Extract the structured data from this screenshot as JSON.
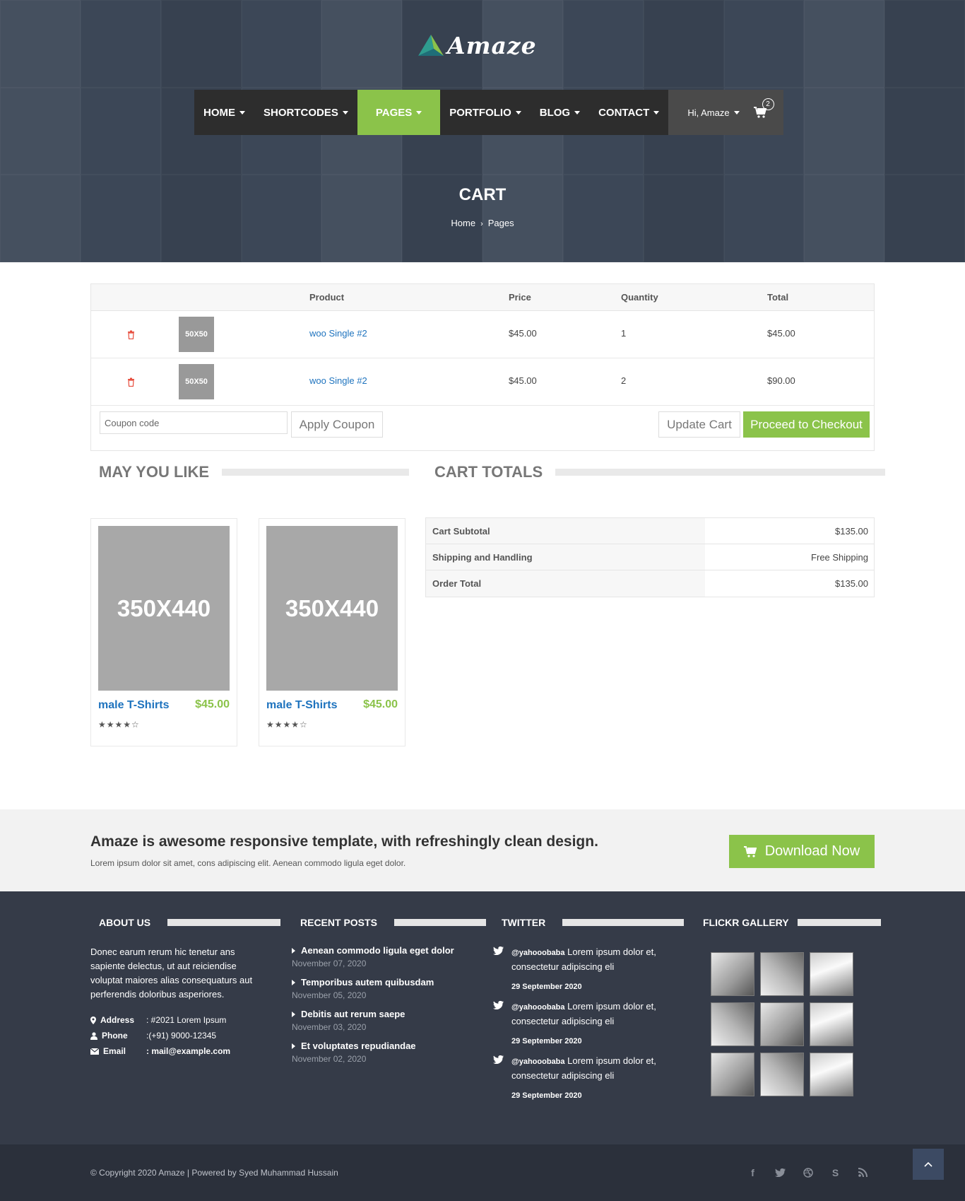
{
  "brand": {
    "name": "Amaze"
  },
  "nav": {
    "items": [
      {
        "label": "HOME"
      },
      {
        "label": "SHORTCODES"
      },
      {
        "label": "PAGES"
      },
      {
        "label": "PORTFOLIO"
      },
      {
        "label": "BLOG"
      },
      {
        "label": "CONTACT"
      }
    ],
    "active_item": "PAGES",
    "user_label": "Hi, Amaze",
    "cart_count": "2",
    "accent_color": "#8bc34a"
  },
  "hero": {
    "title": "CART",
    "breadcrumb": [
      "Home",
      "Pages"
    ]
  },
  "cart": {
    "columns": [
      "Product",
      "Price",
      "Quantity",
      "Total"
    ],
    "rows": [
      {
        "thumb": "50X50",
        "product": "woo Single #2",
        "price": "$45.00",
        "quantity": "1",
        "total": "$45.00"
      },
      {
        "thumb": "50X50",
        "product": "woo Single #2",
        "price": "$45.00",
        "quantity": "2",
        "total": "$90.00"
      }
    ],
    "coupon_placeholder": "Coupon code",
    "apply_label": "Apply Coupon",
    "update_label": "Update Cart",
    "checkout_label": "Proceed to Checkout"
  },
  "may_you_like": {
    "title": "MAY YOU LIKE",
    "products": [
      {
        "image": "350X440",
        "name": "male T-Shirts",
        "price": "$45.00",
        "rating": 4.5
      },
      {
        "image": "350X440",
        "name": "male T-Shirts",
        "price": "$45.00",
        "rating": 4.5
      }
    ]
  },
  "cart_totals": {
    "title": "CART TOTALS",
    "rows": [
      {
        "label": "Cart Subtotal",
        "value": "$135.00"
      },
      {
        "label": "Shipping and Handling",
        "value": "Free Shipping"
      },
      {
        "label": "Order Total",
        "value": "$135.00"
      }
    ]
  },
  "promo": {
    "heading": "Amaze is awesome responsive template, with refreshingly clean design.",
    "text": "Lorem ipsum dolor sit amet, cons adipiscing elit. Aenean commodo ligula eget dolor.",
    "button_label": "Download Now"
  },
  "footer": {
    "about": {
      "title": "ABOUT US",
      "text": "Donec earum rerum hic tenetur ans sapiente delectus, ut aut reiciendise voluptat maiores alias consequaturs aut perferendis doloribus asperiores.",
      "contacts": [
        {
          "label": "Address",
          "value": ": #2021 Lorem Ipsum"
        },
        {
          "label": "Phone",
          "value": ":(+91) 9000-12345"
        },
        {
          "label": "Email",
          "value": ": mail@example.com"
        }
      ]
    },
    "recent_posts": {
      "title": "RECENT POSTS",
      "posts": [
        {
          "title": "Aenean commodo ligula eget dolor",
          "date": "November 07, 2020"
        },
        {
          "title": "Temporibus autem quibusdam",
          "date": "November 05, 2020"
        },
        {
          "title": "Debitis aut rerum saepe",
          "date": "November 03, 2020"
        },
        {
          "title": "Et voluptates repudiandae",
          "date": "November 02, 2020"
        }
      ]
    },
    "twitter": {
      "title": "TWITTER",
      "tweets": [
        {
          "handle": "@yahooobaba",
          "text": " Lorem ipsum dolor et, consectetur adipiscing eli",
          "date": "29 September 2020"
        },
        {
          "handle": "@yahooobaba",
          "text": " Lorem ipsum dolor et, consectetur adipiscing eli",
          "date": "29 September 2020"
        },
        {
          "handle": "@yahooobaba",
          "text": " Lorem ipsum dolor et, consectetur adipiscing eli",
          "date": "29 September 2020"
        }
      ]
    },
    "flickr": {
      "title": "FLICKR GALLERY",
      "count": 9
    },
    "copyright": "© Copyright 2020 Amaze | Powered by Syed Muhammad Hussain",
    "social_icons": [
      "facebook-icon",
      "twitter-icon",
      "dribbble-icon",
      "skype-icon",
      "rss-icon"
    ]
  }
}
